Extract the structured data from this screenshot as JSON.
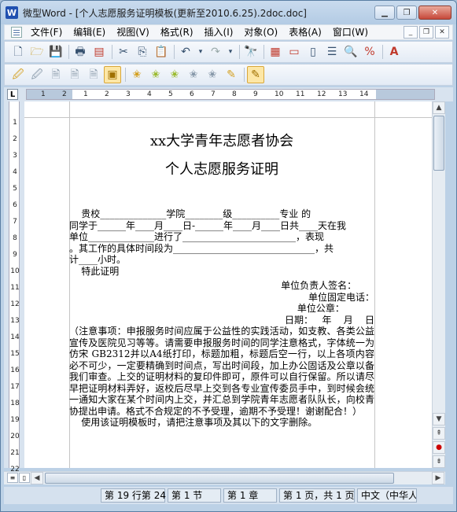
{
  "window": {
    "title": "微型Word - [个人志愿服务证明模板(更新至2010.6.25).2doc.doc]",
    "app_icon": "W",
    "buttons": [
      "minimize",
      "restore",
      "close"
    ]
  },
  "menu": {
    "items": [
      "文件(F)",
      "编辑(E)",
      "视图(V)",
      "格式(R)",
      "插入(I)",
      "对象(O)",
      "表格(A)",
      "窗口(W)"
    ]
  },
  "toolbar1": {
    "icons": [
      "new-document",
      "open-folder",
      "save",
      "print",
      "print-preview-pdf",
      "cut",
      "copy",
      "paste",
      "undo",
      "undo-dropdown",
      "redo",
      "redo-dropdown",
      "find",
      "table",
      "insert-field",
      "view-page",
      "view-outline",
      "zoom",
      "spellcheck",
      "font-color"
    ]
  },
  "toolbar2": {
    "icons": [
      "track-1",
      "track-2",
      "track-3",
      "track-4",
      "track-5",
      "active-tool",
      "star-1",
      "star-2",
      "star-3",
      "star-4",
      "star-5",
      "edit-doc",
      "edit-doc-active"
    ]
  },
  "ruler": {
    "h_labels": [
      "1",
      "2",
      "1",
      "2",
      "3",
      "4",
      "5",
      "6",
      "7",
      "8",
      "9",
      "10",
      "11",
      "12",
      "13",
      "14"
    ],
    "v_labels": [
      "1",
      "2",
      "3",
      "4",
      "5",
      "6",
      "7",
      "8",
      "9",
      "10",
      "11",
      "12",
      "13",
      "14",
      "15",
      "16",
      "17",
      "18",
      "19",
      "20",
      "21",
      "22"
    ]
  },
  "document": {
    "title_line1": "xx大学青年志愿者协会",
    "title_line2": "个人志愿服务证明",
    "lines": [
      "    贵校______________学院________级__________专业 的",
      "同学于______年____月____日-______年____月____日共____天在我",
      "单位______________进行了________________________，表现",
      "。其工作的具体时间段为______________________________，共",
      "计____小时。",
      "    特此证明"
    ],
    "sign_lines": [
      "单位负责人签名：      ",
      "单位固定电话：",
      "单位公章：          ",
      "日期：   年    月    日"
    ],
    "notice": "    （注意事项：申报服务时间应属于公益性的实践活动，如支教、各类公益宣传及医院见习等等。请需要申报服务时间的同学注意格式，字体统一为仿宋 GB2312并以A4纸打印，标题加粗，标题后空一行，以上各项内容必不可少，一定要精确到时间点，写出时间段，加上办公固话及公章以备我们审查。上交的证明材料的复印件即可，原件可以自行保留。所以请尽早把证明材料弄好，返校后尽早上交到各专业宣传委员手中，到时候会统一通知大家在某个时间内上交，并汇总到学院青年志愿者队队长，向校青协提出申请。格式不合规定的不予受理，逾期不予受理！谢谢配合！）",
    "last_line": "    使用该证明模板时，请把注意事项及其以下的文字删除。"
  },
  "status": {
    "cells": [
      "第 19 行第 24",
      "第 1 节",
      "第 1 章",
      "第 1 页，共 1 页",
      "中文（中华人"
    ]
  }
}
